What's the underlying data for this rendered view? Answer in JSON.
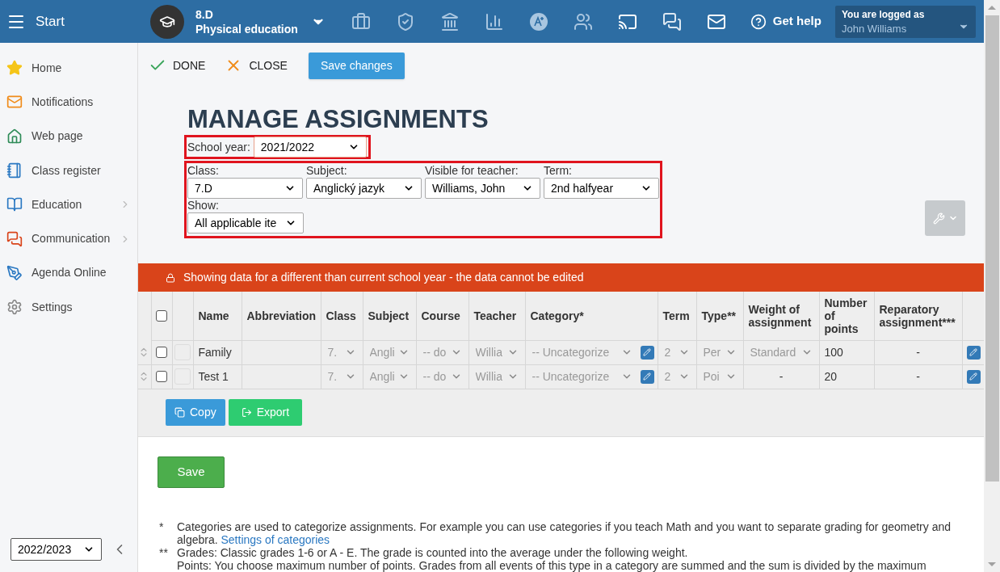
{
  "header": {
    "menu_label": "Start",
    "class_name": "8.D",
    "subject": "Physical education",
    "help": "Get help",
    "login": {
      "label": "You are logged as",
      "user": "John Williams"
    }
  },
  "sidebar": {
    "items": [
      {
        "label": "Home",
        "has_submenu": false
      },
      {
        "label": "Notifications",
        "has_submenu": false
      },
      {
        "label": "Web page",
        "has_submenu": false
      },
      {
        "label": "Class register",
        "has_submenu": false
      },
      {
        "label": "Education",
        "has_submenu": true
      },
      {
        "label": "Communication",
        "has_submenu": true
      },
      {
        "label": "Agenda Online",
        "has_submenu": false
      },
      {
        "label": "Settings",
        "has_submenu": false
      }
    ],
    "year": "2022/2023"
  },
  "toolbar": {
    "done": "DONE",
    "close": "CLOSE",
    "save_changes": "Save changes"
  },
  "title": "MANAGE ASSIGNMENTS",
  "filters": {
    "school_year": {
      "label": "School year:",
      "value": "2021/2022"
    },
    "fields": [
      {
        "label": "Class:",
        "value": "7.D"
      },
      {
        "label": "Subject:",
        "value": "Anglický jazyk"
      },
      {
        "label": "Visible for teacher:",
        "value": "Williams, John"
      },
      {
        "label": "Term:",
        "value": "2nd halfyear"
      }
    ],
    "show": {
      "label": "Show:",
      "value": "All applicable ite"
    }
  },
  "banner": "Showing data for a different than current school year - the data cannot be edited",
  "table": {
    "header_checked": false,
    "columns": [
      "Name",
      "Abbreviation",
      "Class",
      "Subject",
      "Course",
      "Teacher",
      "Category*",
      "Term",
      "Type**",
      "Weight of assignment",
      "Number of points",
      "Reparatory assignment***"
    ],
    "rows": [
      {
        "checked": false,
        "name": "Family",
        "class": "7.",
        "subject": "Angli",
        "course": "-- do",
        "teacher": "Willia",
        "category": "-- Uncategorize",
        "term": "2",
        "type": "Per",
        "weight": {
          "kind": "select",
          "value": "Standard"
        },
        "points": "100",
        "reparatory": "-"
      },
      {
        "checked": false,
        "name": "Test 1",
        "class": "7.",
        "subject": "Angli",
        "course": "-- do",
        "teacher": "Willia",
        "category": "-- Uncategorize",
        "term": "2",
        "type": "Poi",
        "weight": {
          "kind": "text",
          "value": "-"
        },
        "points": "20",
        "reparatory": "-"
      }
    ]
  },
  "actions": {
    "copy": "Copy",
    "export": "Export"
  },
  "save": "Save",
  "footnotes": [
    {
      "mark": "*",
      "paragraphs": [
        "Categories are used to categorize assignments. For example you can use categories if you teach Math and you want to separate grading for geometry and algebra."
      ],
      "link": "Settings of categories"
    },
    {
      "mark": "**",
      "paragraphs": [
        "Grades: Classic grades 1-6 or A - E. The grade is counted into the average under the following weight.",
        "Points: You choose maximum number of points. Grades from all events of this type in a category are summed and the sum is divided by the maximum"
      ]
    }
  ]
}
